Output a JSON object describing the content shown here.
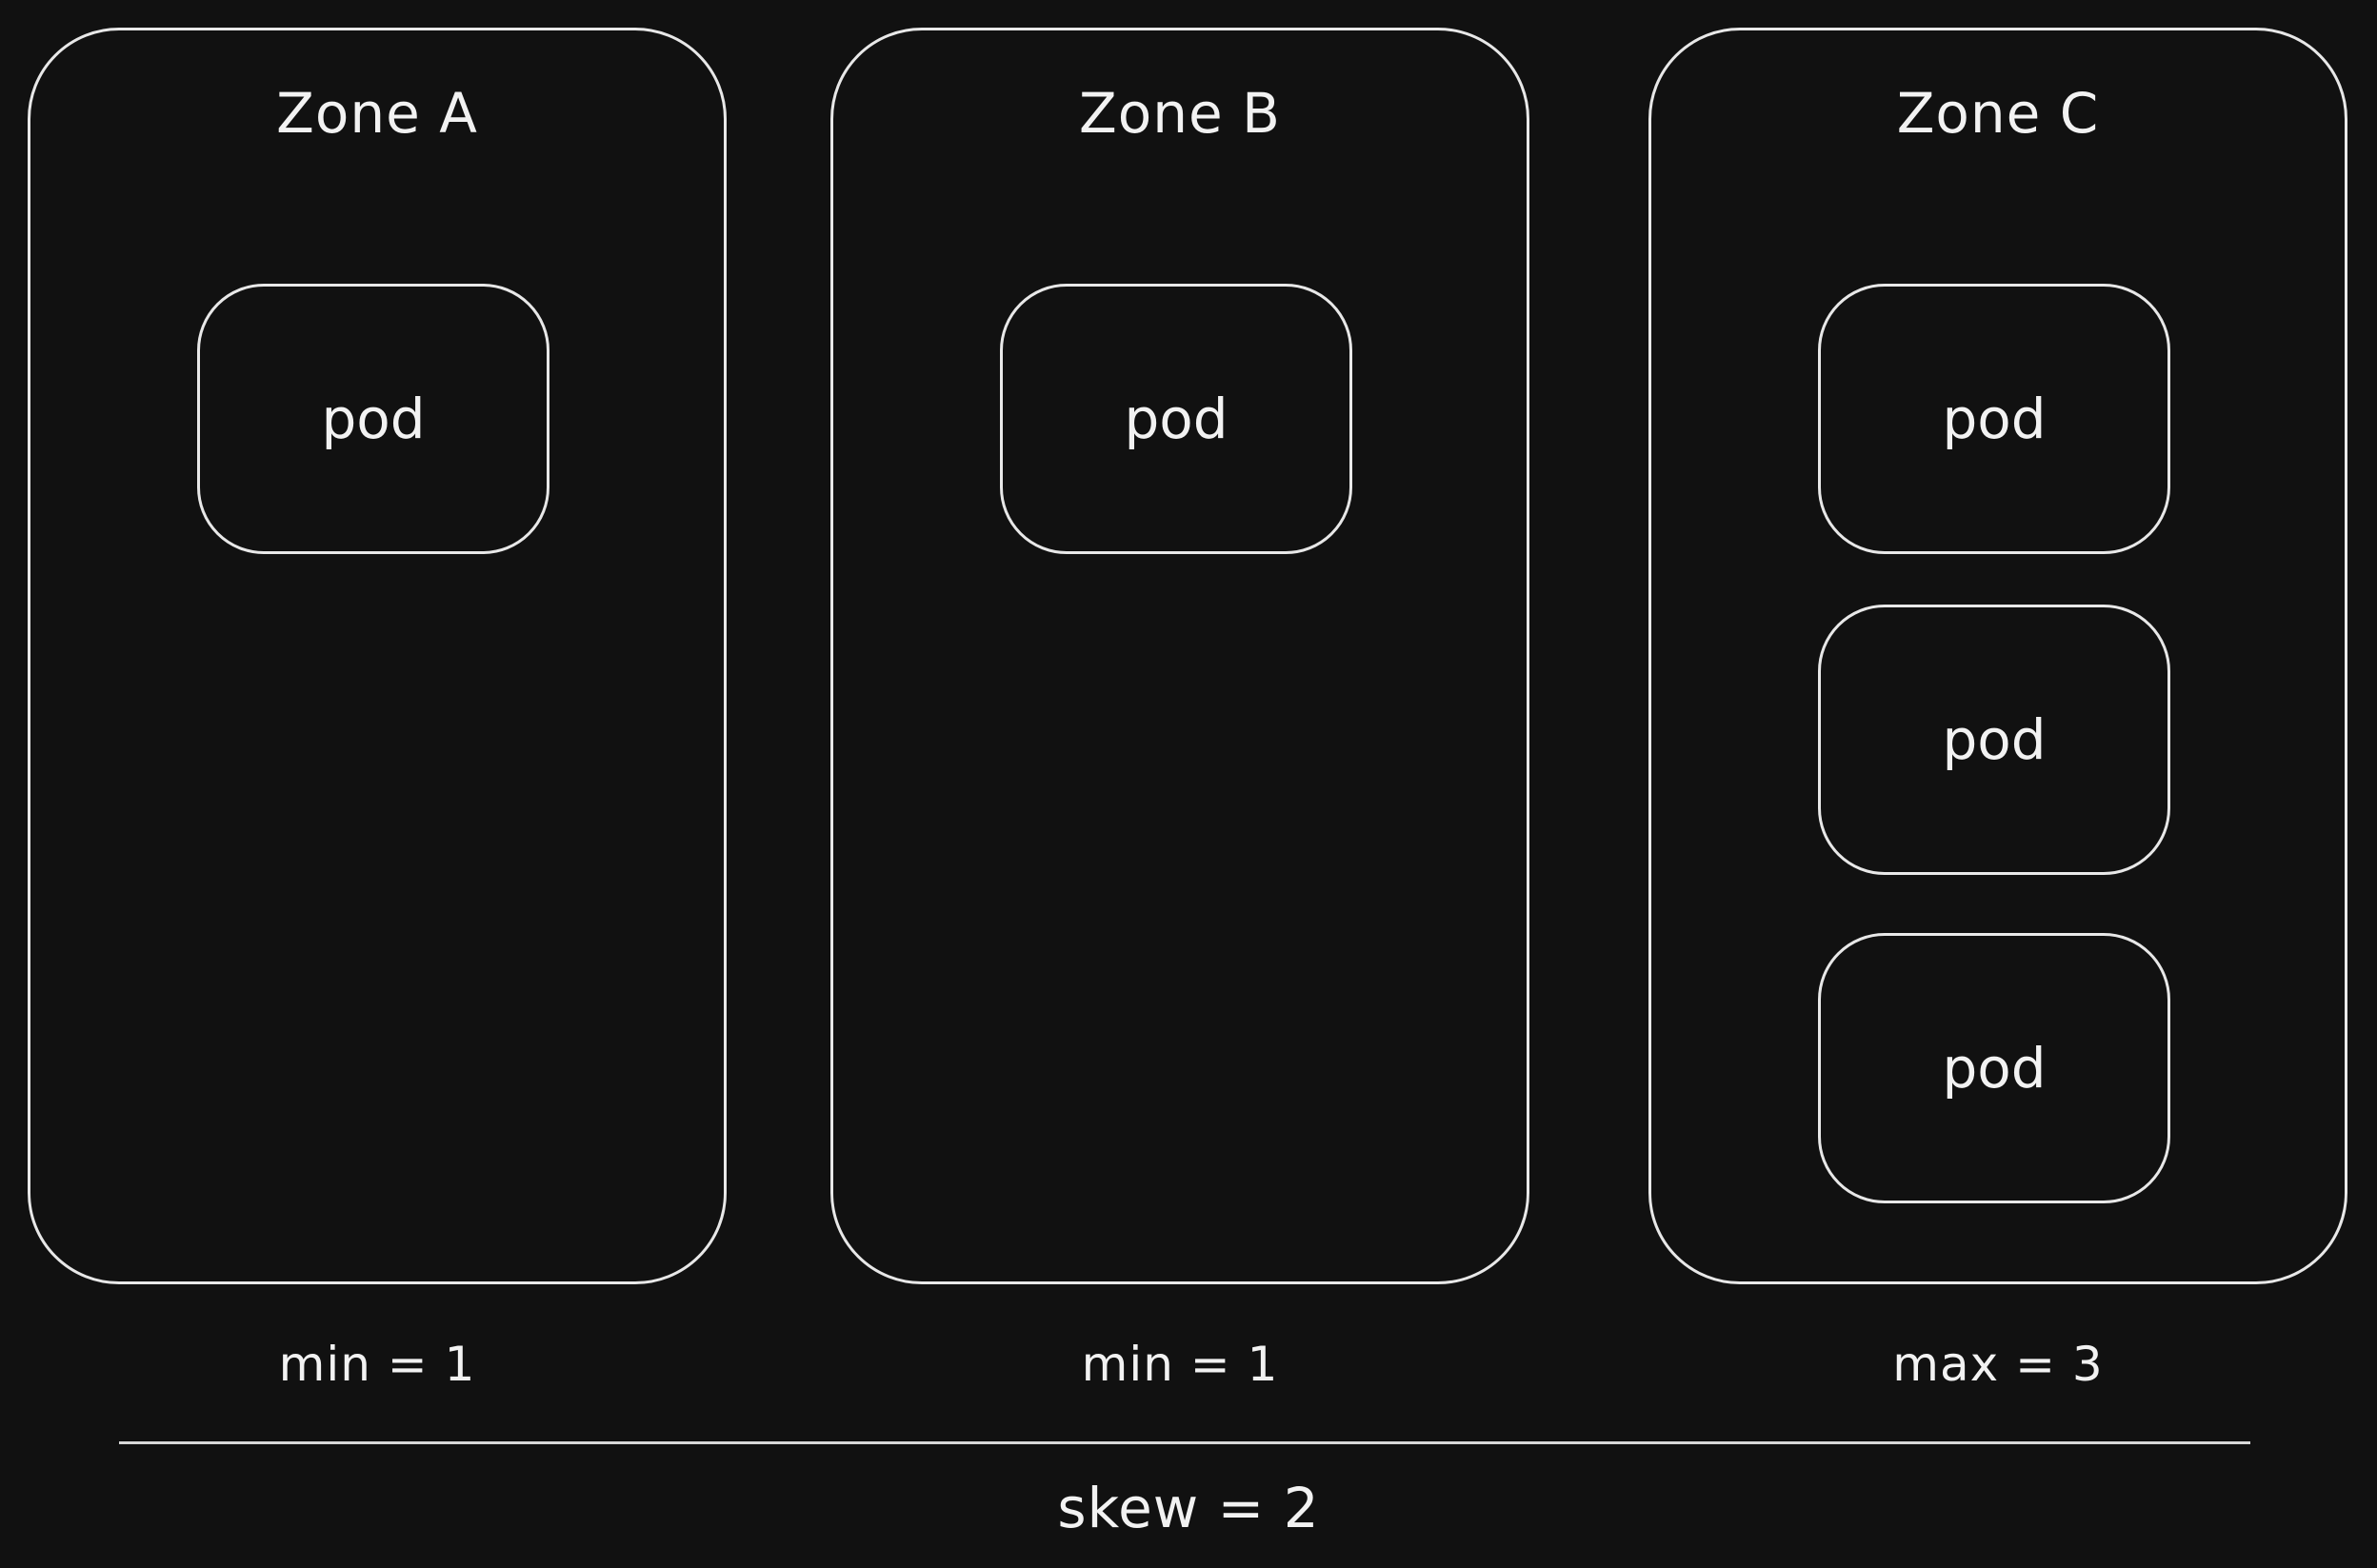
{
  "zones": [
    {
      "title": "Zone A",
      "pods": [
        "pod"
      ],
      "bound": "min = 1"
    },
    {
      "title": "Zone B",
      "pods": [
        "pod"
      ],
      "bound": "min = 1"
    },
    {
      "title": "Zone C",
      "pods": [
        "pod",
        "pod",
        "pod"
      ],
      "bound": "max = 3"
    }
  ],
  "skew": "skew = 2",
  "colors": {
    "background": "#111111",
    "stroke": "#e8e8e8",
    "text": "#f2f2f2"
  }
}
